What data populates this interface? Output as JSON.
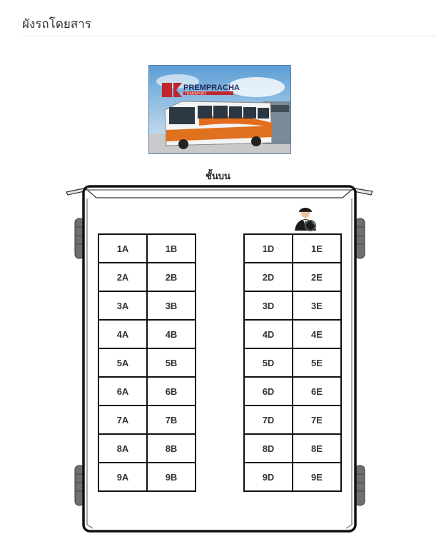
{
  "page": {
    "title": "ผังรถโดยสาร"
  },
  "company_image": {
    "brand": "PREMPRACHA",
    "subbrand": "TRANSPORT"
  },
  "floor_label": "ชั้นบน",
  "seats": {
    "left_block": [
      [
        "1A",
        "1B"
      ],
      [
        "2A",
        "2B"
      ],
      [
        "3A",
        "3B"
      ],
      [
        "4A",
        "4B"
      ],
      [
        "5A",
        "5B"
      ],
      [
        "6A",
        "6B"
      ],
      [
        "7A",
        "7B"
      ],
      [
        "8A",
        "8B"
      ],
      [
        "9A",
        "9B"
      ]
    ],
    "right_block": [
      [
        "1D",
        "1E"
      ],
      [
        "2D",
        "2E"
      ],
      [
        "3D",
        "3E"
      ],
      [
        "4D",
        "4E"
      ],
      [
        "5D",
        "5E"
      ],
      [
        "6D",
        "6E"
      ],
      [
        "7D",
        "7E"
      ],
      [
        "8D",
        "8E"
      ],
      [
        "9D",
        "9E"
      ]
    ]
  },
  "icons": {
    "driver": "driver-icon",
    "wheel": "wheel-icon",
    "mirror": "side-mirror-icon"
  }
}
